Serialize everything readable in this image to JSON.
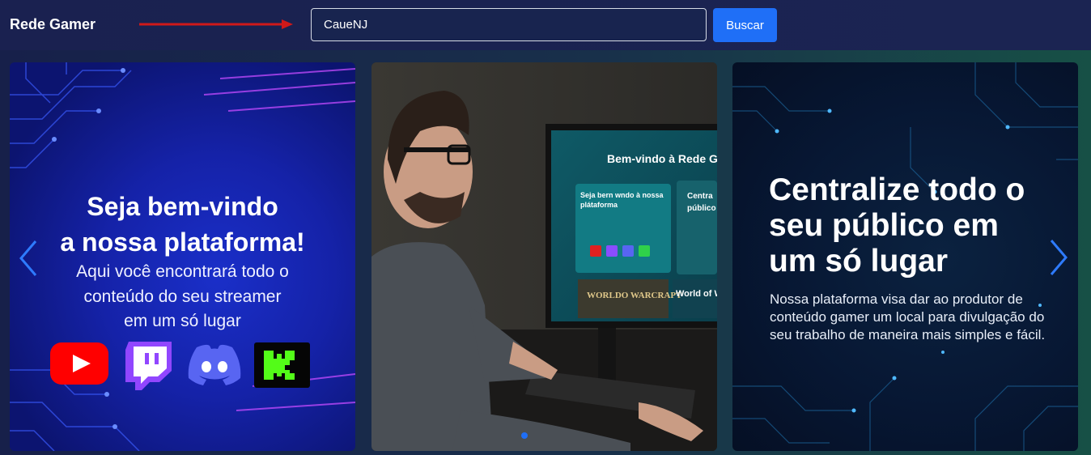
{
  "navbar": {
    "brand": "Rede Gamer",
    "search": {
      "value": "CaueNJ"
    },
    "search_button_label": "Buscar"
  },
  "carousel": {
    "slides": [
      {
        "title_line1": "Seja bem-vindo",
        "title_line2": "a nossa plataforma!",
        "subtitle_line1": "Aqui você encontrará todo o",
        "subtitle_line2": "conteúdo do seu streamer",
        "subtitle_line3": "em um só lugar",
        "logos": [
          "youtube-icon",
          "twitch-icon",
          "discord-icon",
          "kick-icon"
        ]
      },
      {
        "monitor_heading": "Bem-vindo à Rede Ga",
        "monitor_card1": "Seja bern wndo à nossa plátaforma",
        "monitor_card2": "Centra públicos",
        "monitor_banner1": "WORLDO WARCRAPT",
        "monitor_banner2": "World of Wa"
      },
      {
        "title_line1": "Centralize todo o",
        "title_line2": "seu público em",
        "title_line3": "um só lugar",
        "text": "Nossa plataforma visa dar ao produtor de conteúdo gamer um local para divulgação do seu trabalho de maneira mais simples e fácil."
      }
    ],
    "active_index": 1
  },
  "colors": {
    "navbar": "#1a2150",
    "button": "#1f6ff7",
    "annotation_arrow": "#d01919"
  }
}
